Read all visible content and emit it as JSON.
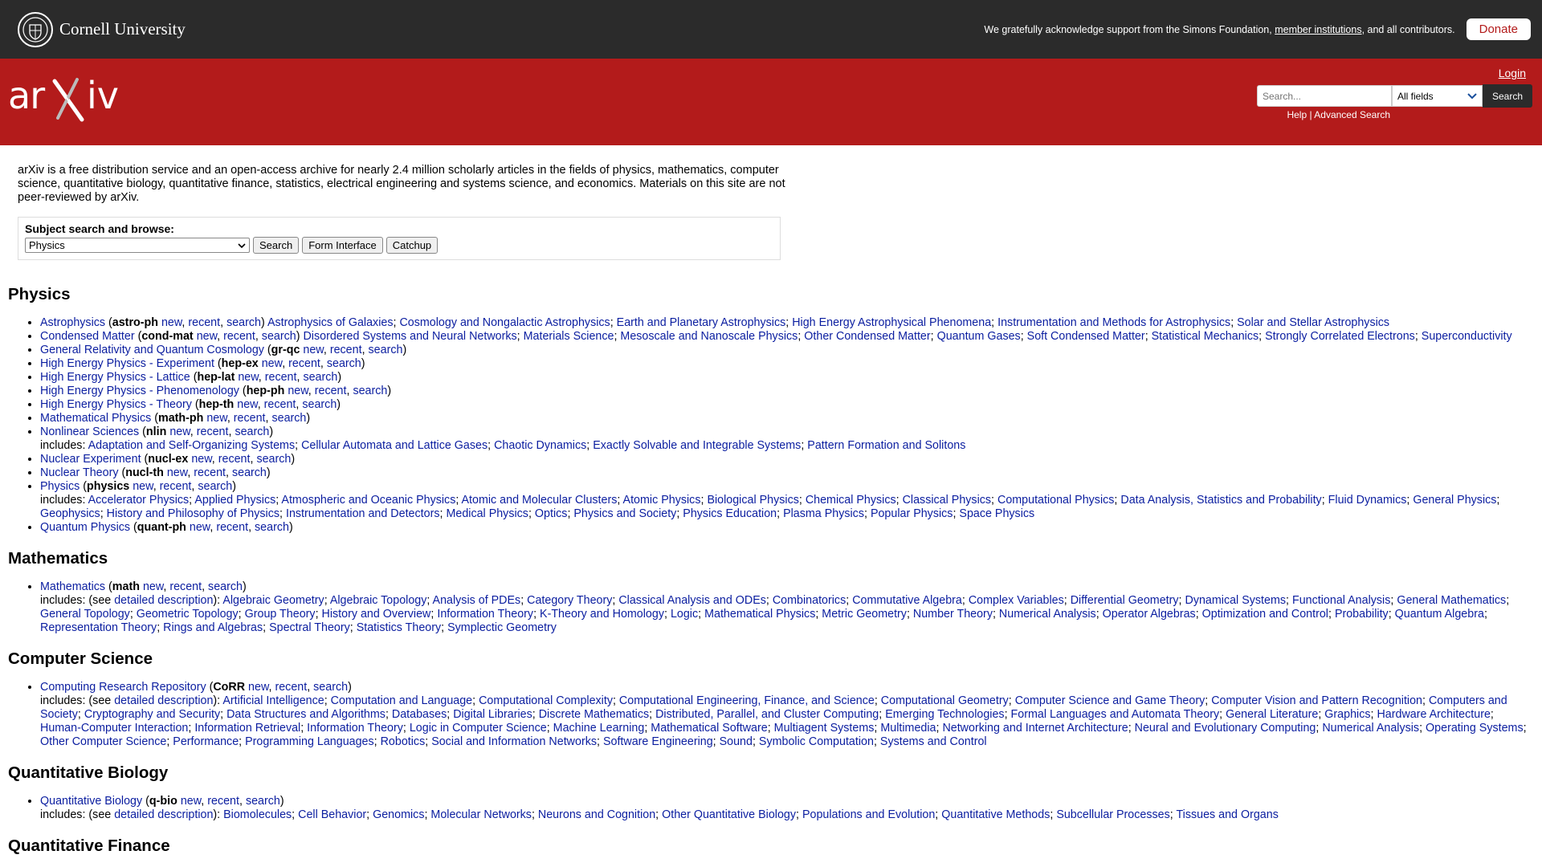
{
  "cornell": {
    "name": "Cornell University",
    "support_text": "We gratefully acknowledge support from the Simons Foundation,",
    "member_link": "member institutions",
    "support_tail": ", and all contributors.",
    "donate": "Donate"
  },
  "header": {
    "login": "Login",
    "search_placeholder": "Search...",
    "field": "All fields",
    "search_btn": "Search",
    "help": "Help",
    "sep": " | ",
    "advanced": "Advanced Search",
    "brand_colors": {
      "red": "#b31b1b",
      "dark": "#2b2b2b",
      "link": "#0b1ea0"
    }
  },
  "intro": "arXiv is a free distribution service and an open-access archive for nearly 2.4 million scholarly articles in the fields of physics, mathematics, computer science, quantitative biology, quantitative finance, statistics, electrical engineering and systems science, and economics. Materials on this site are not peer-reviewed by arXiv.",
  "browse": {
    "label": "Subject search and browse:",
    "selected": "Physics",
    "search": "Search",
    "form": "Form Interface",
    "catchup": "Catchup"
  },
  "sections": [
    {
      "title": "Physics",
      "items": [
        {
          "name": "Astrophysics",
          "code": "astro-ph",
          "subs": [
            "Astrophysics of Galaxies",
            "Cosmology and Nongalactic Astrophysics",
            "Earth and Planetary Astrophysics",
            "High Energy Astrophysical Phenomena",
            "Instrumentation and Methods for Astrophysics",
            "Solar and Stellar Astrophysics"
          ],
          "inline": true
        },
        {
          "name": "Condensed Matter",
          "code": "cond-mat",
          "subs": [
            "Disordered Systems and Neural Networks",
            "Materials Science",
            "Mesoscale and Nanoscale Physics",
            "Other Condensed Matter",
            "Quantum Gases",
            "Soft Condensed Matter",
            "Statistical Mechanics",
            "Strongly Correlated Electrons",
            "Superconductivity"
          ],
          "inline": true
        },
        {
          "name": "General Relativity and Quantum Cosmology",
          "code": "gr-qc"
        },
        {
          "name": "High Energy Physics - Experiment",
          "code": "hep-ex"
        },
        {
          "name": "High Energy Physics - Lattice",
          "code": "hep-lat"
        },
        {
          "name": "High Energy Physics - Phenomenology",
          "code": "hep-ph"
        },
        {
          "name": "High Energy Physics - Theory",
          "code": "hep-th"
        },
        {
          "name": "Mathematical Physics",
          "code": "math-ph"
        },
        {
          "name": "Nonlinear Sciences",
          "code": "nlin",
          "subs": [
            "Adaptation and Self-Organizing Systems",
            "Cellular Automata and Lattice Gases",
            "Chaotic Dynamics",
            "Exactly Solvable and Integrable Systems",
            "Pattern Formation and Solitons"
          ]
        },
        {
          "name": "Nuclear Experiment",
          "code": "nucl-ex"
        },
        {
          "name": "Nuclear Theory",
          "code": "nucl-th"
        },
        {
          "name": "Physics",
          "code": "physics",
          "subs": [
            "Accelerator Physics",
            "Applied Physics",
            "Atmospheric and Oceanic Physics",
            "Atomic and Molecular Clusters",
            "Atomic Physics",
            "Biological Physics",
            "Chemical Physics",
            "Classical Physics",
            "Computational Physics",
            "Data Analysis, Statistics and Probability",
            "Fluid Dynamics",
            "General Physics",
            "Geophysics",
            "History and Philosophy of Physics",
            "Instrumentation and Detectors",
            "Medical Physics",
            "Optics",
            "Physics and Society",
            "Physics Education",
            "Plasma Physics",
            "Popular Physics",
            "Space Physics"
          ]
        },
        {
          "name": "Quantum Physics",
          "code": "quant-ph"
        }
      ]
    },
    {
      "title": "Mathematics",
      "items": [
        {
          "name": "Mathematics",
          "code": "math",
          "detailed": true,
          "subs": [
            "Algebraic Geometry",
            "Algebraic Topology",
            "Analysis of PDEs",
            "Category Theory",
            "Classical Analysis and ODEs",
            "Combinatorics",
            "Commutative Algebra",
            "Complex Variables",
            "Differential Geometry",
            "Dynamical Systems",
            "Functional Analysis",
            "General Mathematics",
            "General Topology",
            "Geometric Topology",
            "Group Theory",
            "History and Overview",
            "Information Theory",
            "K-Theory and Homology",
            "Logic",
            "Mathematical Physics",
            "Metric Geometry",
            "Number Theory",
            "Numerical Analysis",
            "Operator Algebras",
            "Optimization and Control",
            "Probability",
            "Quantum Algebra",
            "Representation Theory",
            "Rings and Algebras",
            "Spectral Theory",
            "Statistics Theory",
            "Symplectic Geometry"
          ]
        }
      ]
    },
    {
      "title": "Computer Science",
      "items": [
        {
          "name": "Computing Research Repository",
          "code": "CoRR",
          "detailed": true,
          "subs": [
            "Artificial Intelligence",
            "Computation and Language",
            "Computational Complexity",
            "Computational Engineering, Finance, and Science",
            "Computational Geometry",
            "Computer Science and Game Theory",
            "Computer Vision and Pattern Recognition",
            "Computers and Society",
            "Cryptography and Security",
            "Data Structures and Algorithms",
            "Databases",
            "Digital Libraries",
            "Discrete Mathematics",
            "Distributed, Parallel, and Cluster Computing",
            "Emerging Technologies",
            "Formal Languages and Automata Theory",
            "General Literature",
            "Graphics",
            "Hardware Architecture",
            "Human-Computer Interaction",
            "Information Retrieval",
            "Information Theory",
            "Logic in Computer Science",
            "Machine Learning",
            "Mathematical Software",
            "Multiagent Systems",
            "Multimedia",
            "Networking and Internet Architecture",
            "Neural and Evolutionary Computing",
            "Numerical Analysis",
            "Operating Systems",
            "Other Computer Science",
            "Performance",
            "Programming Languages",
            "Robotics",
            "Social and Information Networks",
            "Software Engineering",
            "Sound",
            "Symbolic Computation",
            "Systems and Control"
          ]
        }
      ]
    },
    {
      "title": "Quantitative Biology",
      "items": [
        {
          "name": "Quantitative Biology",
          "code": "q-bio",
          "detailed": true,
          "subs": [
            "Biomolecules",
            "Cell Behavior",
            "Genomics",
            "Molecular Networks",
            "Neurons and Cognition",
            "Other Quantitative Biology",
            "Populations and Evolution",
            "Quantitative Methods",
            "Subcellular Processes",
            "Tissues and Organs"
          ]
        }
      ]
    },
    {
      "title": "Quantitative Finance",
      "items": []
    }
  ],
  "words": {
    "new": "new",
    "recent": "recent",
    "search": "search",
    "includes": "includes:",
    "see": "(see",
    "detailed": "detailed description",
    "close_paren": ")"
  }
}
